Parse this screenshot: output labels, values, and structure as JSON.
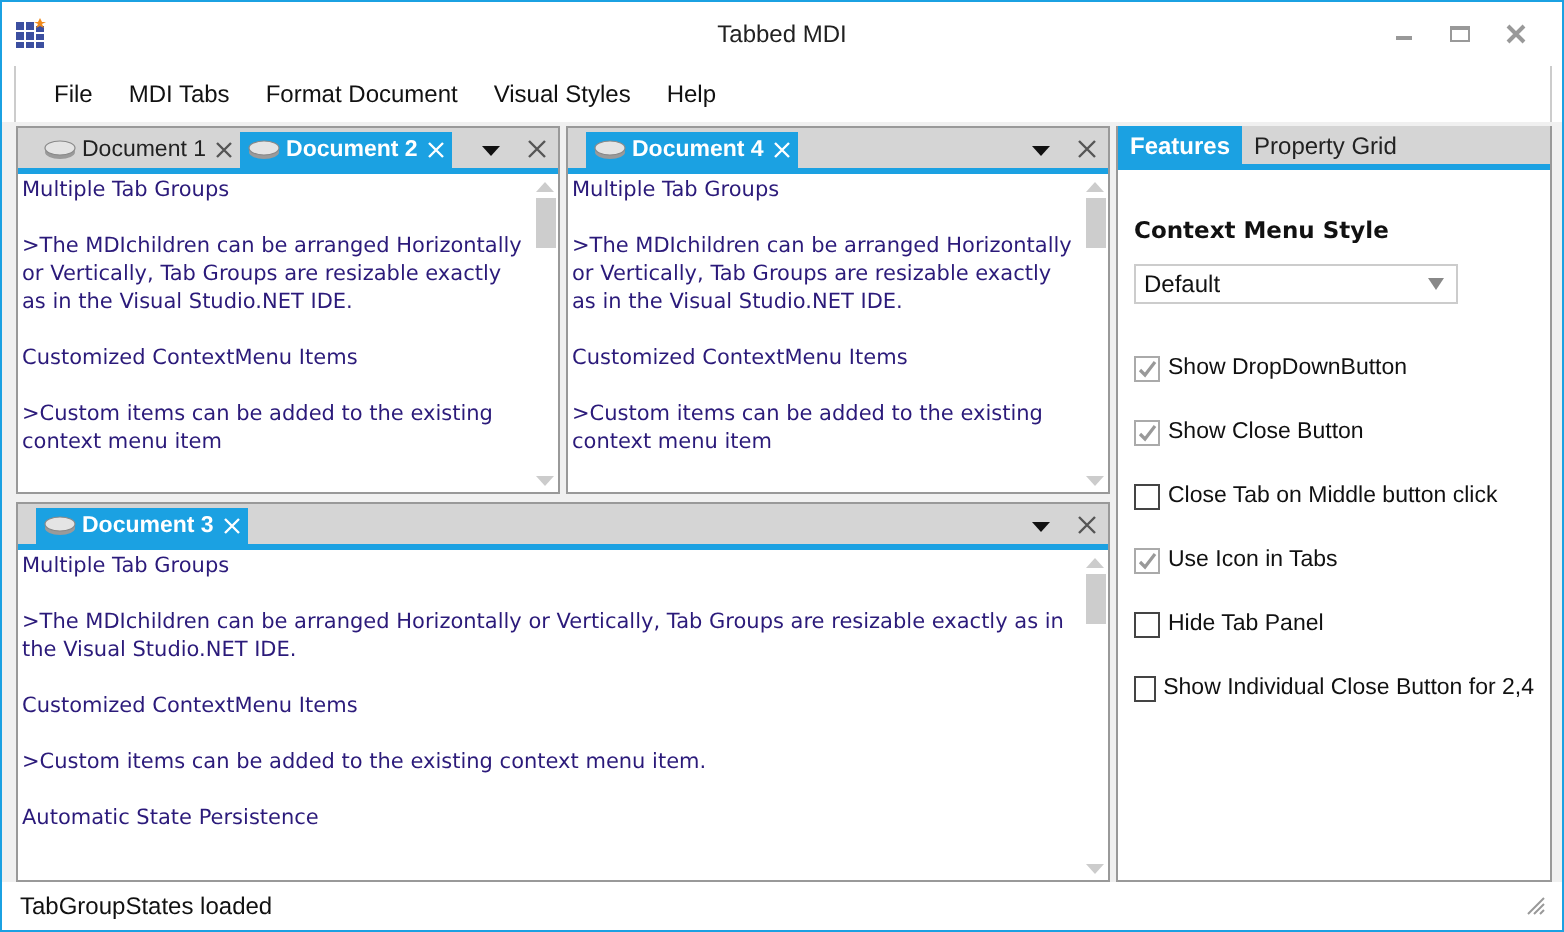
{
  "window": {
    "title": "Tabbed MDI"
  },
  "menu": [
    "File",
    "MDI Tabs",
    "Format Document",
    "Visual Styles",
    "Help"
  ],
  "tab_groups": [
    {
      "tabs": [
        {
          "label": "Document 1",
          "selected": false
        },
        {
          "label": "Document 2",
          "selected": true
        }
      ],
      "paragraphs": [
        "Multiple Tab Groups",
        ">The MDIchildren can be arranged Horizontally or Vertically, Tab Groups are resizable exactly as in the Visual Studio.NET IDE.",
        "Customized ContextMenu Items",
        ">Custom items can be added to the existing context menu item"
      ]
    },
    {
      "tabs": [
        {
          "label": "Document 4",
          "selected": true
        }
      ],
      "paragraphs": [
        "Multiple Tab Groups",
        ">The MDIchildren can be arranged Horizontally or Vertically, Tab Groups are resizable exactly as in the Visual Studio.NET IDE.",
        "Customized ContextMenu Items",
        ">Custom items can be added to the existing context menu item"
      ]
    },
    {
      "tabs": [
        {
          "label": "Document 3",
          "selected": true
        }
      ],
      "paragraphs": [
        "Multiple Tab Groups",
        ">The MDIchildren can be arranged Horizontally or Vertically, Tab Groups are resizable exactly as in the Visual Studio.NET IDE.",
        "Customized ContextMenu Items",
        ">Custom items can be added to the existing context menu item.",
        "Automatic State Persistence"
      ]
    }
  ],
  "side_panel": {
    "tabs": [
      {
        "label": "Features",
        "selected": true
      },
      {
        "label": "Property Grid",
        "selected": false
      }
    ],
    "heading": "Context Menu Style",
    "dropdown": {
      "value": "Default"
    },
    "options": [
      {
        "label": "Show DropDownButton",
        "checked": true,
        "disabled": true
      },
      {
        "label": "Show Close Button",
        "checked": true,
        "disabled": true
      },
      {
        "label": "Close Tab on Middle button click",
        "checked": false,
        "disabled": false
      },
      {
        "label": "Use Icon in Tabs",
        "checked": true,
        "disabled": true
      },
      {
        "label": "Hide Tab Panel",
        "checked": false,
        "disabled": false
      },
      {
        "label": "Show Individual Close Button for 2,4",
        "checked": false,
        "disabled": false
      }
    ]
  },
  "status_bar": {
    "text": "TabGroupStates loaded"
  }
}
